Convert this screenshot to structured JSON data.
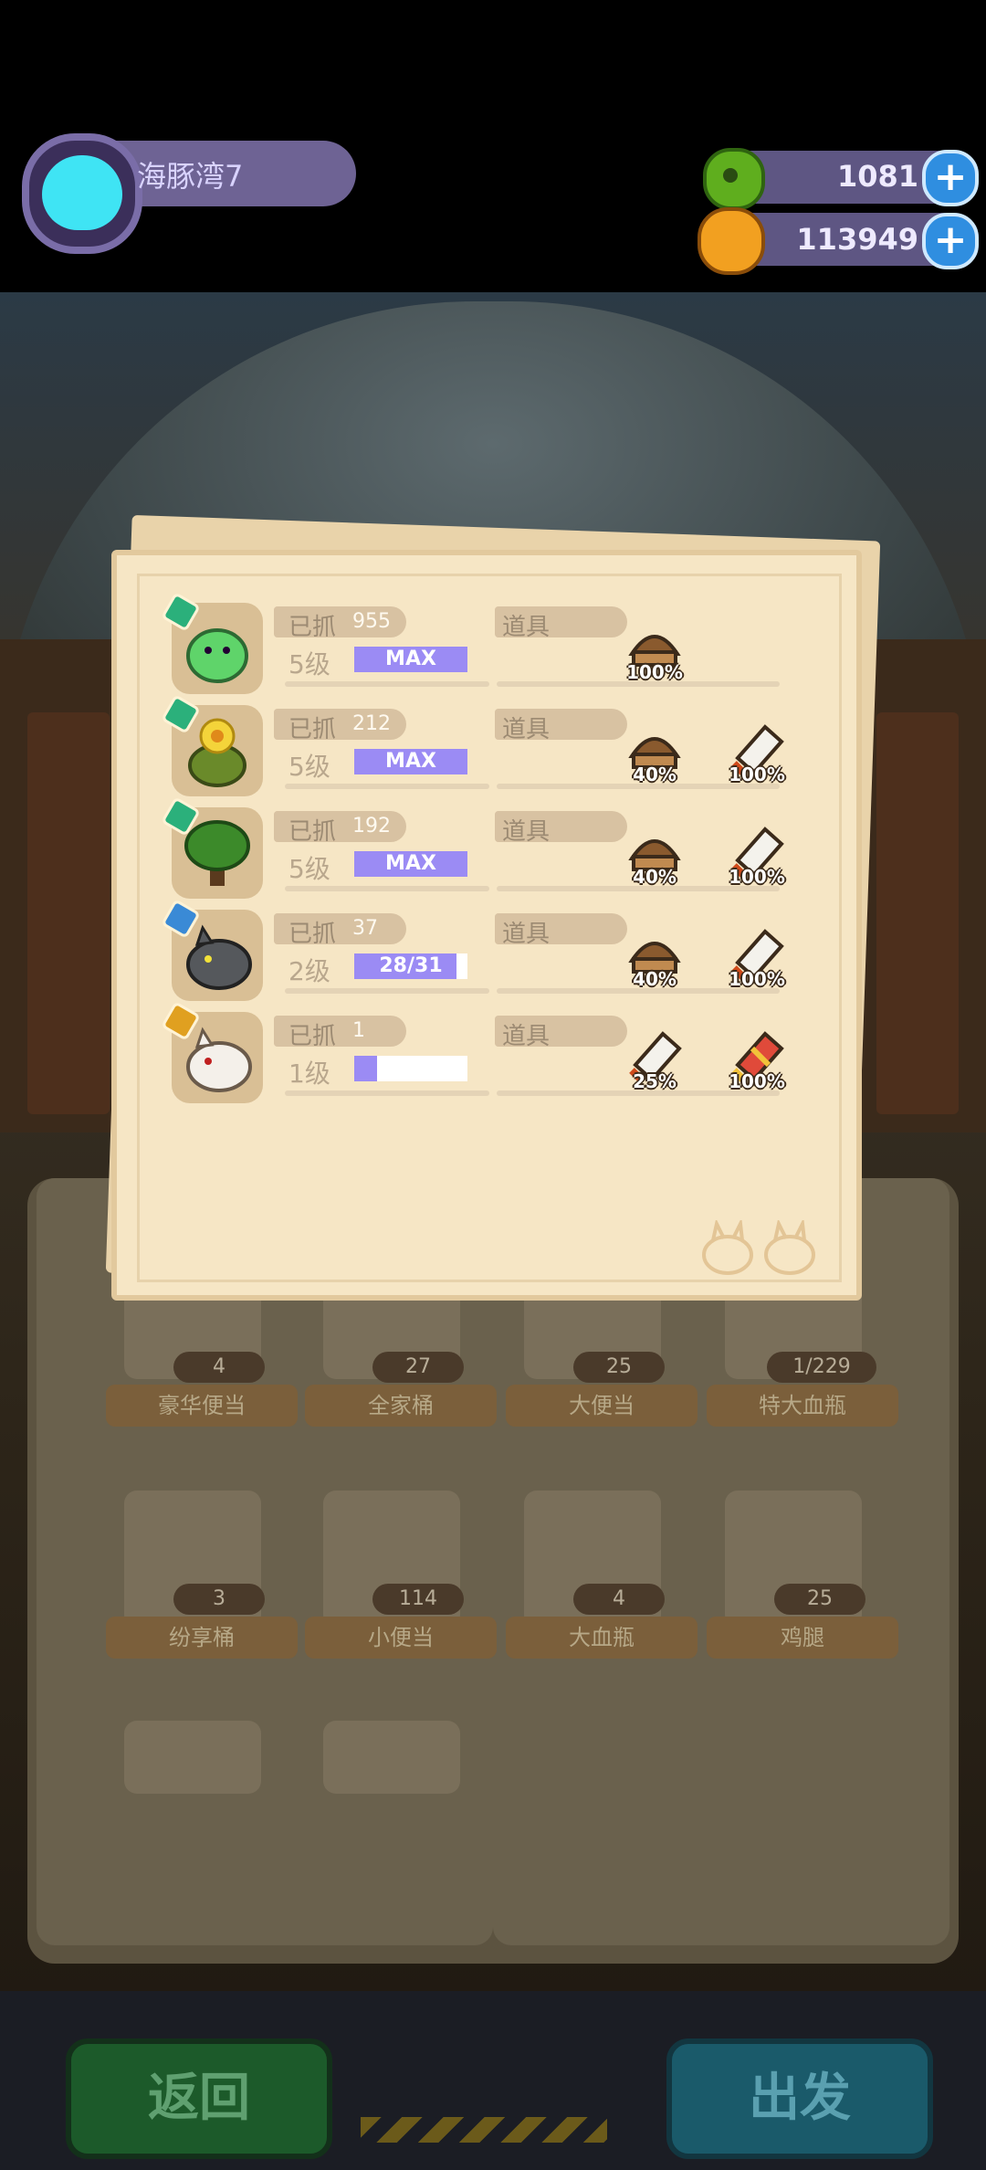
{
  "player": {
    "name": "海豚湾7",
    "avatar_icon": "cat-face-icon"
  },
  "currencies": [
    {
      "name": "green-gem",
      "icon": "green-donut-coin-icon",
      "amount": "1081"
    },
    {
      "name": "gold-coin",
      "icon": "gold-planet-coin-icon",
      "amount": "113949"
    }
  ],
  "popup": {
    "caught_label": "已抓",
    "props_label": "道具",
    "rows": [
      {
        "monster_icon": "green-slime-icon",
        "badge_color": "#2bb07b",
        "caught": "955",
        "level": "5级",
        "progress_text": "MAX",
        "progress": 1.0,
        "drops": [
          {
            "icon": "brown-nut-icon",
            "pct": "100%"
          }
        ]
      },
      {
        "monster_icon": "flower-bush-icon",
        "badge_color": "#2bb07b",
        "caught": "212",
        "level": "5级",
        "progress_text": "MAX",
        "progress": 1.0,
        "drops": [
          {
            "icon": "brown-nut-icon",
            "pct": "40%"
          },
          {
            "icon": "paper-scroll-icon",
            "pct": "100%"
          }
        ]
      },
      {
        "monster_icon": "tree-monster-icon",
        "badge_color": "#2bb07b",
        "caught": "192",
        "level": "5级",
        "progress_text": "MAX",
        "progress": 1.0,
        "drops": [
          {
            "icon": "brown-nut-icon",
            "pct": "40%"
          },
          {
            "icon": "paper-scroll-icon",
            "pct": "100%"
          }
        ]
      },
      {
        "monster_icon": "grey-wolf-icon",
        "badge_color": "#3a8ad6",
        "caught": "37",
        "level": "2级",
        "progress_text": "28/31",
        "progress": 0.903,
        "drops": [
          {
            "icon": "brown-nut-icon",
            "pct": "40%"
          },
          {
            "icon": "paper-scroll-icon",
            "pct": "100%"
          }
        ]
      },
      {
        "monster_icon": "white-wolf-icon",
        "badge_color": "#e0a020",
        "caught": "1",
        "level": "1级",
        "progress_text": "1/5",
        "progress": 0.2,
        "drops": [
          {
            "icon": "paper-scroll-icon",
            "pct": "25%"
          },
          {
            "icon": "red-scroll-icon",
            "pct": "100%"
          }
        ]
      }
    ]
  },
  "items": [
    {
      "name": "豪华便当",
      "count": "4"
    },
    {
      "name": "全家桶",
      "count": "27"
    },
    {
      "name": "大便当",
      "count": "25"
    },
    {
      "name": "特大血瓶",
      "count": "1/229"
    },
    {
      "name": "纷享桶",
      "count": "3"
    },
    {
      "name": "小便当",
      "count": "114"
    },
    {
      "name": "大血瓶",
      "count": "4"
    },
    {
      "name": "鸡腿",
      "count": "25"
    }
  ],
  "buttons": {
    "back": "返回",
    "go": "出发"
  }
}
